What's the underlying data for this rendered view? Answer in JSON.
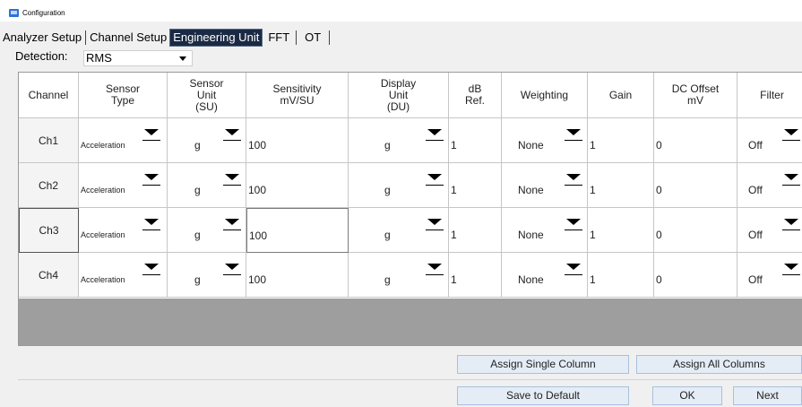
{
  "window": {
    "title": "Configuration"
  },
  "tabs": [
    {
      "label": "Analyzer Setup",
      "active": false
    },
    {
      "label": "Channel Setup",
      "active": false
    },
    {
      "label": "Engineering Unit",
      "active": true
    },
    {
      "label": "FFT",
      "active": false
    },
    {
      "label": "OT",
      "active": false
    }
  ],
  "detection": {
    "label": "Detection:",
    "value": "RMS"
  },
  "table": {
    "headers": [
      "Channel",
      "Sensor\nType",
      "Sensor\nUnit\n(SU)",
      "Sensitivity\nmV/SU",
      "Display\nUnit\n(DU)",
      "dB\nRef.",
      "Weighting",
      "Gain",
      "DC Offset\nmV",
      "Filter"
    ],
    "rows": [
      {
        "channel": "Ch1",
        "sensor_type": "Acceleration",
        "sensor_unit": "g",
        "sensitivity": "100",
        "display_unit": "g",
        "db_ref": "1",
        "weighting": "None",
        "gain": "1",
        "dc_offset": "0",
        "filter": "Off"
      },
      {
        "channel": "Ch2",
        "sensor_type": "Acceleration",
        "sensor_unit": "g",
        "sensitivity": "100",
        "display_unit": "g",
        "db_ref": "1",
        "weighting": "None",
        "gain": "1",
        "dc_offset": "0",
        "filter": "Off"
      },
      {
        "channel": "Ch3",
        "sensor_type": "Acceleration",
        "sensor_unit": "g",
        "sensitivity": "100",
        "display_unit": "g",
        "db_ref": "1",
        "weighting": "None",
        "gain": "1",
        "dc_offset": "0",
        "filter": "Off"
      },
      {
        "channel": "Ch4",
        "sensor_type": "Acceleration",
        "sensor_unit": "g",
        "sensitivity": "100",
        "display_unit": "g",
        "db_ref": "1",
        "weighting": "None",
        "gain": "1",
        "dc_offset": "0",
        "filter": "Off"
      }
    ]
  },
  "buttons": {
    "assign_single": "Assign Single Column",
    "assign_all": "Assign All Columns",
    "save_default": "Save to Default",
    "ok": "OK",
    "next": "Next"
  },
  "colors": {
    "active_tab_bg": "#1b2a44",
    "button_bg": "#e4edf6",
    "button_border": "#a7c0dc",
    "empty_area": "#9e9e9e"
  }
}
